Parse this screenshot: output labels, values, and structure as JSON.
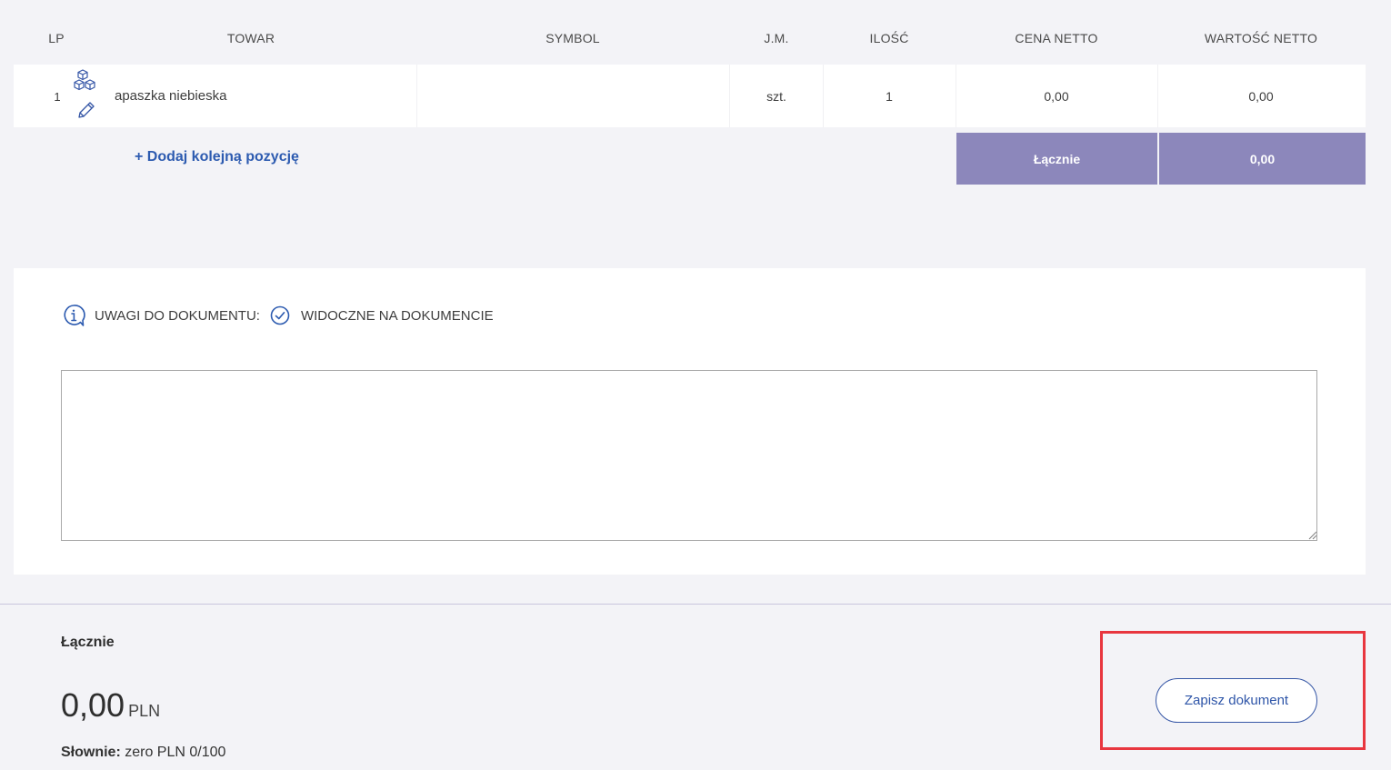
{
  "table": {
    "headers": {
      "lp": "LP",
      "towar": "TOWAR",
      "symbol": "SYMBOL",
      "jm": "J.M.",
      "ilosc": "ILOŚĆ",
      "cena_netto": "CENA NETTO",
      "wartosc_netto": "WARTOŚĆ NETTO"
    },
    "rows": [
      {
        "lp": "1",
        "towar": "apaszka niebieska",
        "symbol": "",
        "jm": "szt.",
        "ilosc": "1",
        "cena_netto": "0,00",
        "wartosc_netto": "0,00",
        "icons": [
          "boxes-icon",
          "pencil-icon"
        ]
      }
    ],
    "add_item_label": "+ Dodaj kolejną pozycję",
    "summary_label": "Łącznie",
    "summary_value": "0,00"
  },
  "notes": {
    "label": "UWAGI DO DOKUMENTU:",
    "visible_label": "WIDOCZNE NA DOKUMENCIE",
    "value": "",
    "icons": [
      "info-icon",
      "check-circle-icon"
    ]
  },
  "footer": {
    "total_label": "Łącznie",
    "total_amount": "0,00",
    "currency": "PLN",
    "in_words_label": "Słownie:",
    "in_words_value": " zero PLN 0/100",
    "save_button_label": "Zapisz dokument"
  },
  "colors": {
    "accent_blue": "#2d5bb0",
    "summary_purple": "#8c87bb",
    "highlight_red": "#e8363f",
    "background": "#f3f3f7"
  }
}
